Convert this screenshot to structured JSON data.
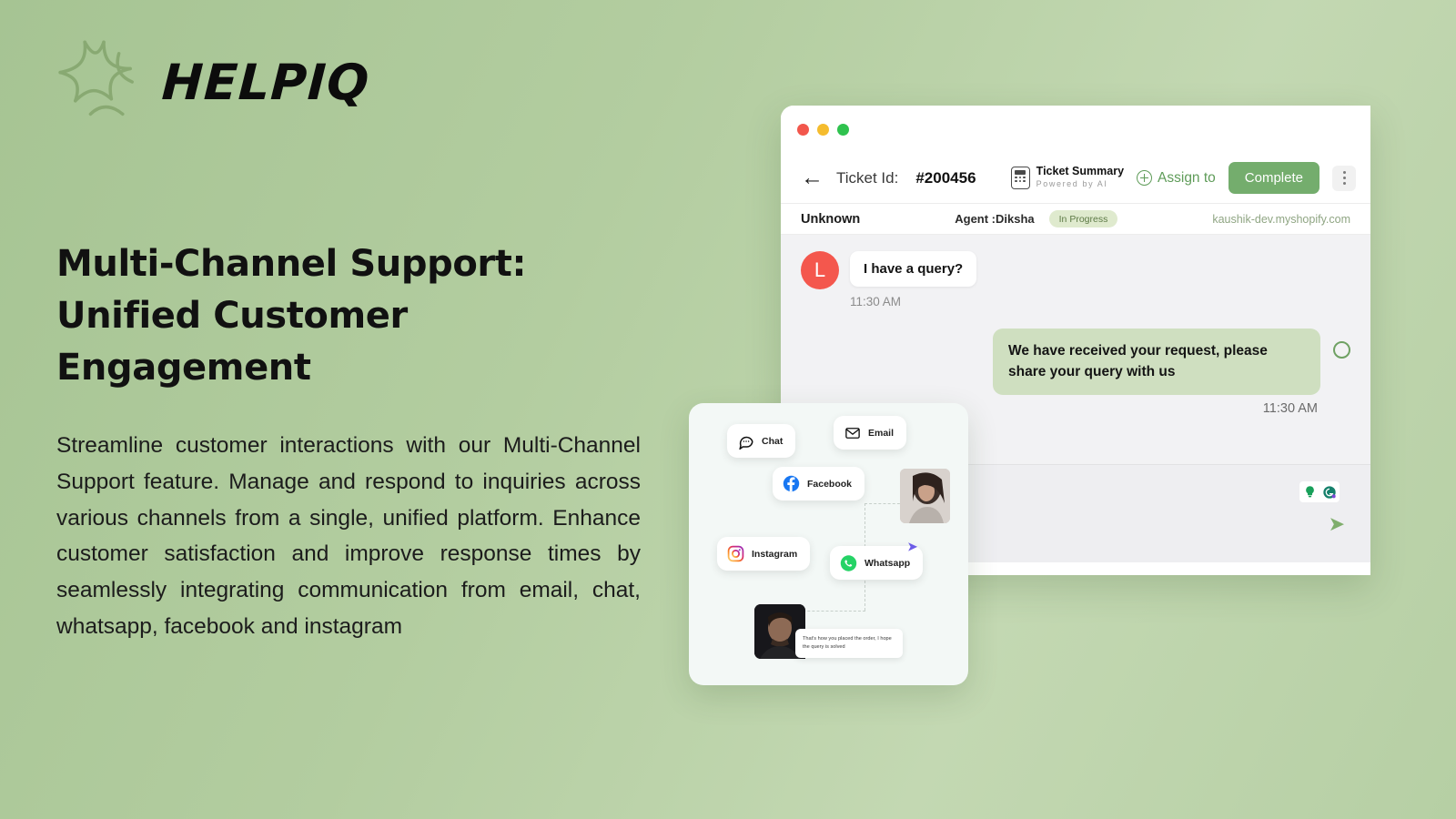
{
  "brand": {
    "name": "HELPIQ",
    "logo_icon": "sparkle-burst-icon"
  },
  "hero": {
    "headline": "Multi-Channel Support: Unified Customer Engagement",
    "body": "Streamline customer interactions with our Multi-Channel Support feature. Manage and respond to inquiries across various channels from a single, unified platform. Enhance customer satisfaction and improve response times by seamlessly integrating communication from email, chat, whatsapp, facebook and instagram"
  },
  "app": {
    "toolbar": {
      "back_icon": "arrow-left-icon",
      "ticket_label": "Ticket Id:",
      "ticket_id": "#200456",
      "summary_icon": "calculator-icon",
      "summary_title": "Ticket Summary",
      "summary_subtitle": "Powered by AI",
      "assign_label": "Assign to",
      "assign_icon": "plus-circle-icon",
      "complete_label": "Complete",
      "menu_icon": "kebab-menu-icon"
    },
    "subbar": {
      "customer": "Unknown",
      "agent": "Agent :Diksha",
      "status": "In Progress",
      "store_domain": "kaushik-dev.myshopify.com"
    },
    "messages": [
      {
        "direction": "incoming",
        "avatar_initial": "L",
        "avatar_color": "#f4574d",
        "text": "I have a query?",
        "time": "11:30 AM"
      },
      {
        "direction": "outgoing",
        "text": "We have received your request, please share your query with us",
        "time": "11:30 AM"
      }
    ],
    "composer": {
      "placeholder": "",
      "value": "",
      "tool_icons": [
        "lightbulb-icon",
        "grammarly-icon"
      ],
      "send_icon": "send-arrow-icon"
    }
  },
  "channel_card": {
    "channels": [
      {
        "label": "Chat",
        "icon": "chat-bubble-icon"
      },
      {
        "label": "Email",
        "icon": "envelope-icon"
      },
      {
        "label": "Facebook",
        "icon": "facebook-icon"
      },
      {
        "label": "Instagram",
        "icon": "instagram-icon"
      },
      {
        "label": "Whatsapp",
        "icon": "whatsapp-icon"
      }
    ],
    "mini_message": "That's how you placed the order, I hope the query is solved",
    "plane_icon": "paper-plane-icon"
  },
  "colors": {
    "background_from": "#a6c493",
    "background_to": "#c3d8b2",
    "accent_green": "#74ad6d",
    "badge_bg": "#dfeace",
    "avatar_red": "#f4574d",
    "bubble_out": "#cfdfc0"
  }
}
